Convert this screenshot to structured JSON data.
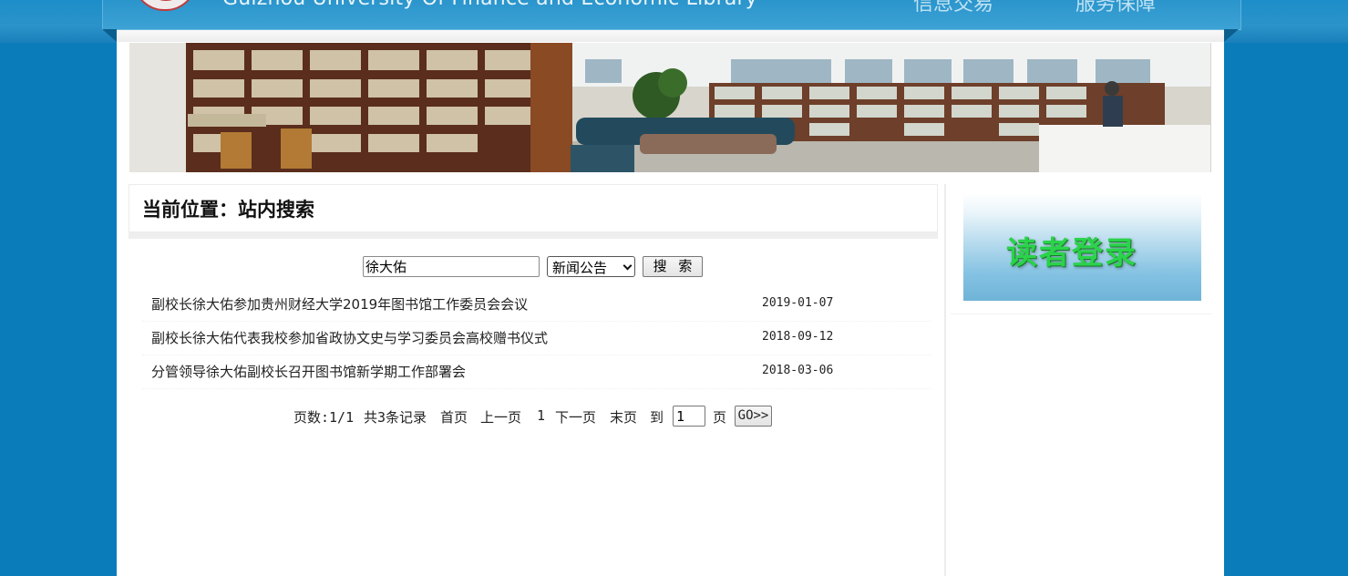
{
  "header": {
    "site_title": "Guizhou University Of Finance and Economic Library",
    "nav": [
      {
        "label": "信息交易"
      },
      {
        "label": "服务保障"
      }
    ]
  },
  "breadcrumb": {
    "label": "当前位置：站内搜索"
  },
  "search": {
    "keyword": "徐大佑",
    "category": "新闻公告",
    "button_label": "搜 索"
  },
  "results": [
    {
      "title": "副校长徐大佑参加贵州财经大学2019年图书馆工作委员会会议",
      "date": "2019-01-07"
    },
    {
      "title": "副校长徐大佑代表我校参加省政协文史与学习委员会高校赠书仪式",
      "date": "2018-09-12"
    },
    {
      "title": "分管领导徐大佑副校长召开图书馆新学期工作部署会",
      "date": "2018-03-06"
    }
  ],
  "pager": {
    "pages": "页数:1/1",
    "records": "共3条记录",
    "first": "首页",
    "prev": "上一页",
    "current": "1",
    "next": "下一页",
    "last": "末页",
    "goto_prefix": "到",
    "goto_value": "1",
    "goto_suffix": "页",
    "go_label": "GO>>"
  },
  "sidebar": {
    "login_label": "读者登录"
  },
  "colors": {
    "background": "#0a7cba",
    "login_text": "#2ad34a"
  },
  "icons": {
    "select_arrow": "chevron-down-icon"
  }
}
